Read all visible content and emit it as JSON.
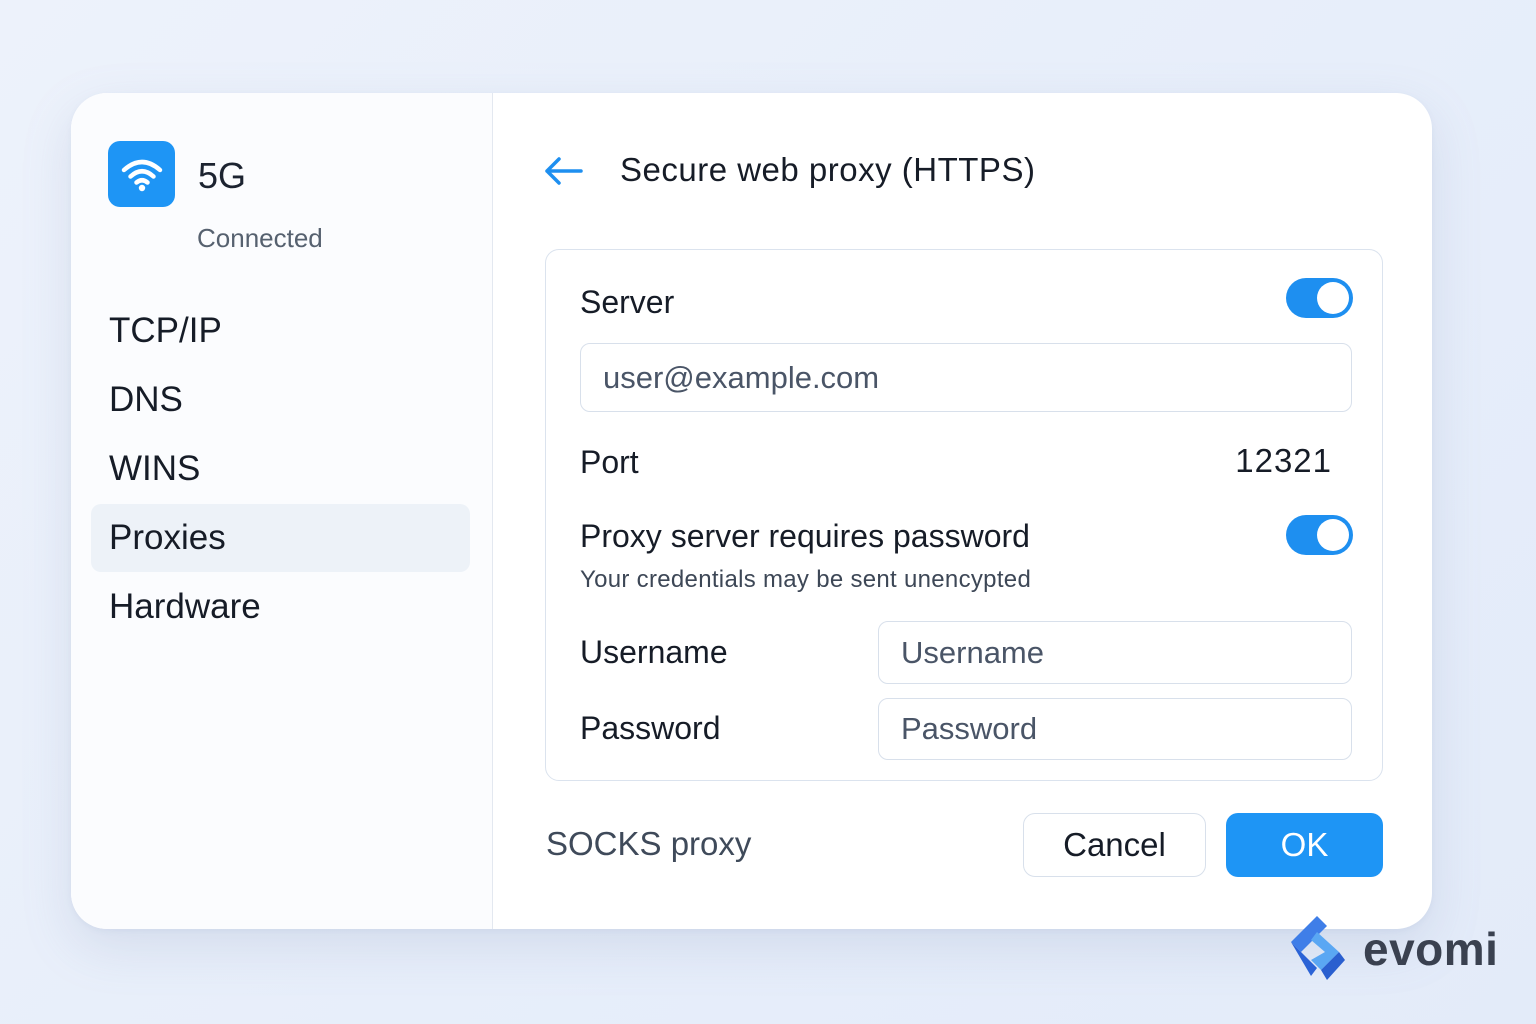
{
  "sidebar": {
    "network": {
      "icon": "wifi-icon",
      "name": "5G",
      "status": "Connected"
    },
    "items": [
      {
        "label": "TCP/IP",
        "active": false
      },
      {
        "label": "DNS",
        "active": false
      },
      {
        "label": "WINS",
        "active": false
      },
      {
        "label": "Proxies",
        "active": true
      },
      {
        "label": "Hardware",
        "active": false
      }
    ]
  },
  "header": {
    "back_icon": "arrow-left-icon",
    "title": "Secure web proxy (HTTPS)"
  },
  "form": {
    "server_label": "Server",
    "server_toggle_on": true,
    "server_placeholder": "user@example.com",
    "port_label": "Port",
    "port_value": "12321",
    "password_required_label": "Proxy server requires password",
    "password_required_toggle_on": true,
    "password_hint": "Your credentials may be sent unencypted",
    "username_label": "Username",
    "username_placeholder": "Username",
    "password_label": "Password",
    "password_placeholder": "Password"
  },
  "footer": {
    "socks_label": "SOCKS proxy",
    "cancel_label": "Cancel",
    "ok_label": "OK"
  },
  "brand": {
    "logo_icon": "evomi-logo-icon",
    "text": "evomi"
  },
  "colors": {
    "accent": "#1e95f5",
    "background": "#e9f0fb",
    "text": "#161c27"
  }
}
